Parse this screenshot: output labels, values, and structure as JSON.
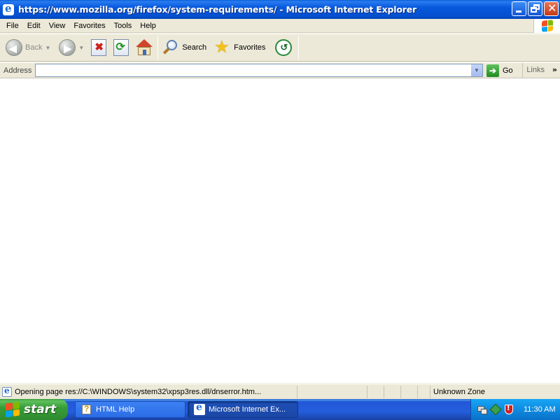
{
  "window": {
    "title": "https://www.mozilla.org/firefox/system-requirements/ - Microsoft Internet Explorer"
  },
  "menu": {
    "items": [
      "File",
      "Edit",
      "View",
      "Favorites",
      "Tools",
      "Help"
    ]
  },
  "toolbar": {
    "back_label": "Back",
    "search_label": "Search",
    "favorites_label": "Favorites"
  },
  "address": {
    "label": "Address",
    "value": "",
    "go_label": "Go",
    "links_label": "Links"
  },
  "status": {
    "text": "Opening page res://C:\\WINDOWS\\system32\\xpsp3res.dll/dnserror.htm...",
    "zone": "Unknown Zone"
  },
  "taskbar": {
    "start_label": "start",
    "tasks": [
      "HTML Help",
      "Microsoft Internet Ex..."
    ],
    "clock": "11:30 AM"
  },
  "colors": {
    "titlebar": "#0758dc",
    "taskbar": "#245edc",
    "start": "#389d38",
    "close_button": "#c33a16"
  }
}
